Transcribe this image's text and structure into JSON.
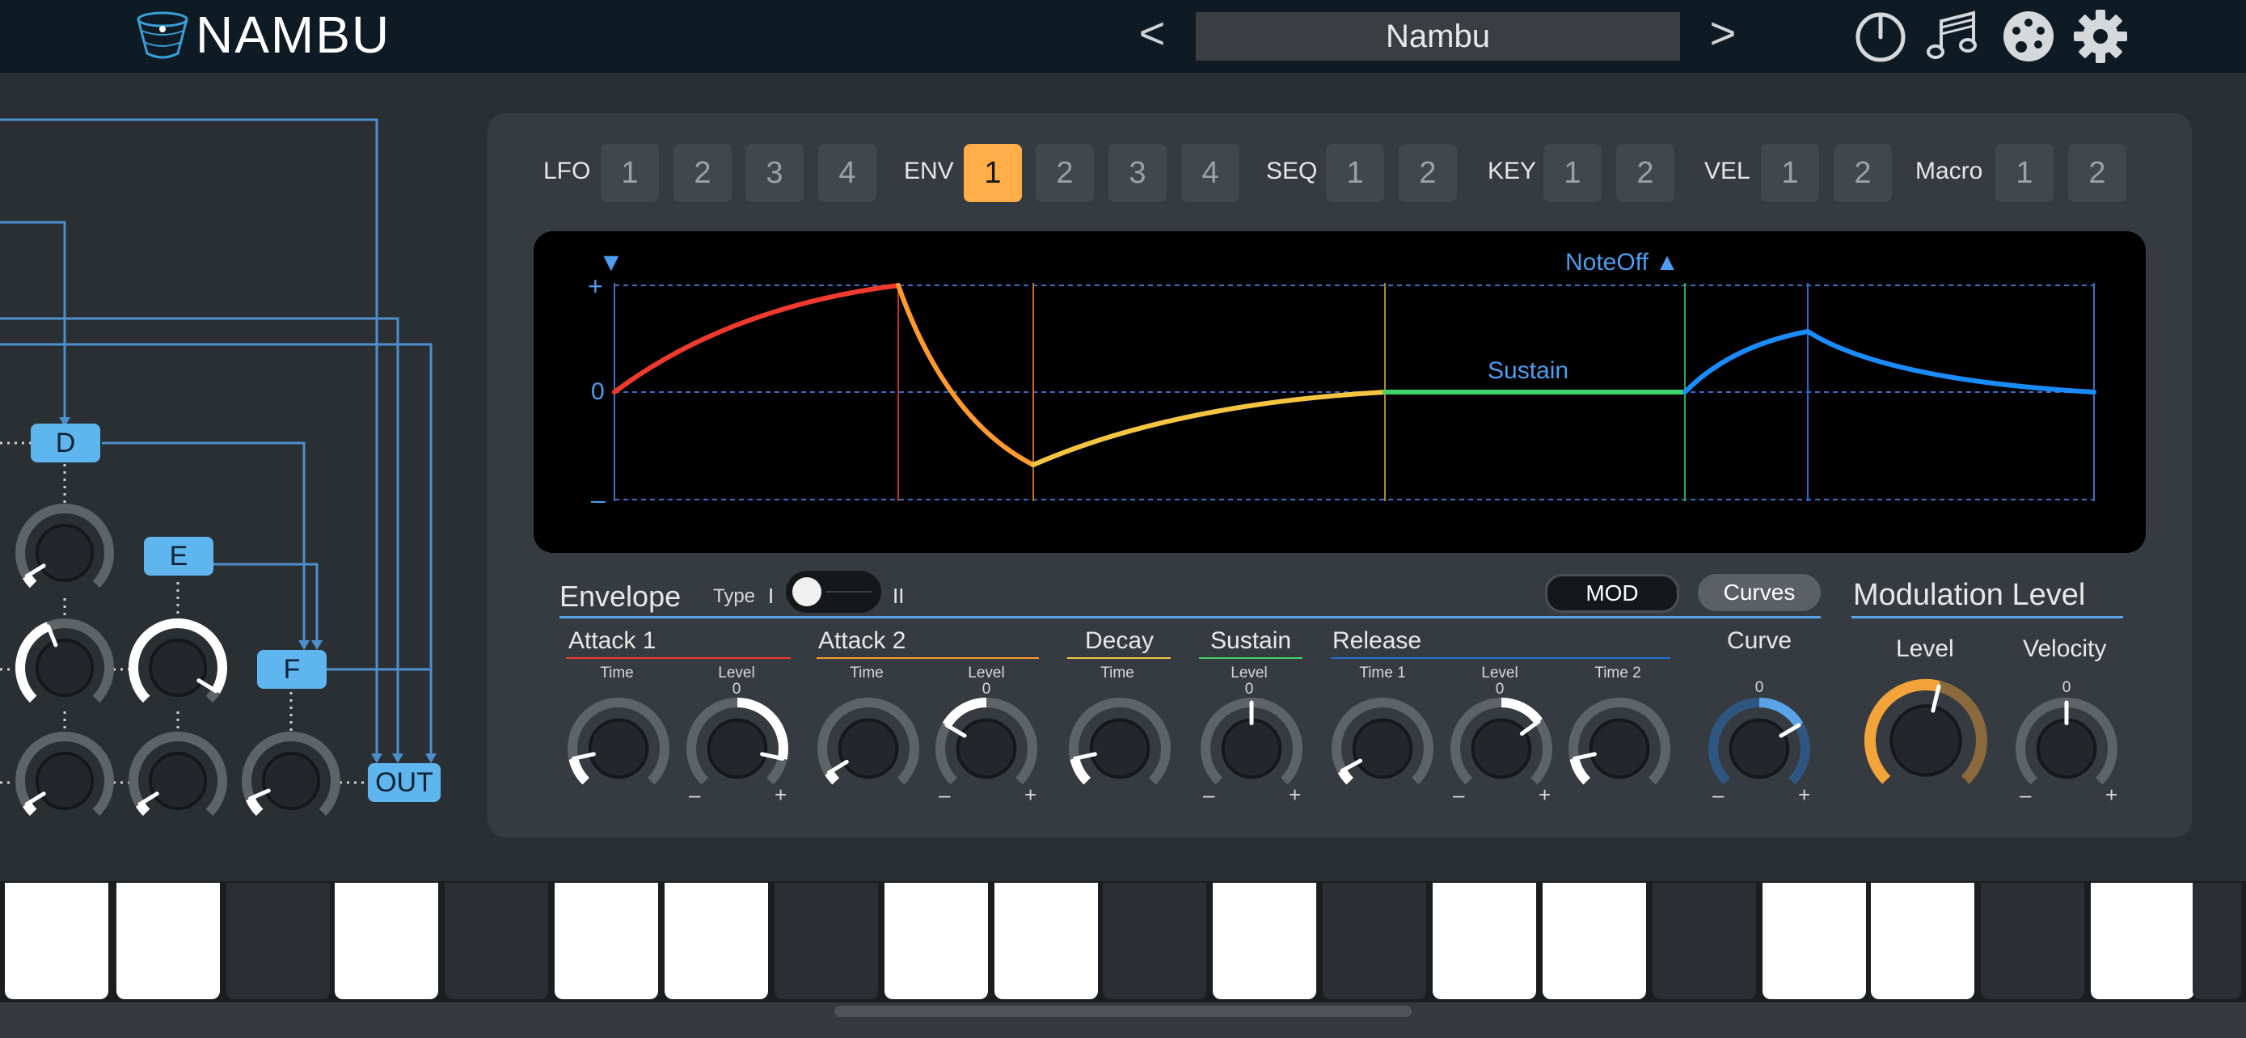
{
  "header": {
    "app_name": "NAMBU",
    "preset_prev": "<",
    "preset_next": ">",
    "preset_name": "Nambu",
    "icons": [
      "power-icon",
      "music-notes-icon",
      "palette-icon",
      "gear-icon"
    ]
  },
  "routing": {
    "operators": [
      "D",
      "E",
      "F"
    ],
    "output_label": "OUT"
  },
  "mod_tabs": {
    "groups": [
      {
        "label": "LFO",
        "buttons": [
          "1",
          "2",
          "3",
          "4"
        ]
      },
      {
        "label": "ENV",
        "buttons": [
          "1",
          "2",
          "3",
          "4"
        ]
      },
      {
        "label": "SEQ",
        "buttons": [
          "1",
          "2"
        ]
      },
      {
        "label": "KEY",
        "buttons": [
          "1",
          "2"
        ]
      },
      {
        "label": "VEL",
        "buttons": [
          "1",
          "2"
        ]
      },
      {
        "label": "Macro",
        "buttons": [
          "1",
          "2"
        ]
      }
    ],
    "active": "ENV 1",
    "active_color": "#ffae4a"
  },
  "graph": {
    "plus_label": "+",
    "zero_label": "0",
    "minus_label": "–",
    "noteoff_label": "NoteOff ▲",
    "start_marker": "▼",
    "sustain_label": "Sustain",
    "colors": {
      "attack1": "#f03a2e",
      "attack2": "#ff9a2e",
      "decay": "#f5c542",
      "sustain": "#43d36b",
      "release": "#1a8cff",
      "grid": "#3d6fc8"
    }
  },
  "envelope": {
    "title": "Envelope",
    "type_label": "Type",
    "type_left": "I",
    "type_right": "II",
    "mod_button": "MOD",
    "curves_button": "Curves",
    "sections": {
      "attack1": {
        "label": "Attack 1",
        "time": "Time",
        "level": "Level",
        "level_value": "0"
      },
      "attack2": {
        "label": "Attack 2",
        "time": "Time",
        "level": "Level",
        "level_value": "0"
      },
      "decay": {
        "label": "Decay",
        "time": "Time"
      },
      "sustain": {
        "label": "Sustain",
        "level": "Level",
        "level_value": "0"
      },
      "release": {
        "label": "Release",
        "time1": "Time 1",
        "level": "Level",
        "level_value": "0",
        "time2": "Time 2"
      },
      "curve": {
        "label": "Curve",
        "value": "0"
      }
    },
    "minus": "–",
    "plus": "+"
  },
  "modulation_level": {
    "title": "Modulation Level",
    "level_label": "Level",
    "velocity_label": "Velocity",
    "velocity_value": "0",
    "minus": "–",
    "plus": "+"
  }
}
